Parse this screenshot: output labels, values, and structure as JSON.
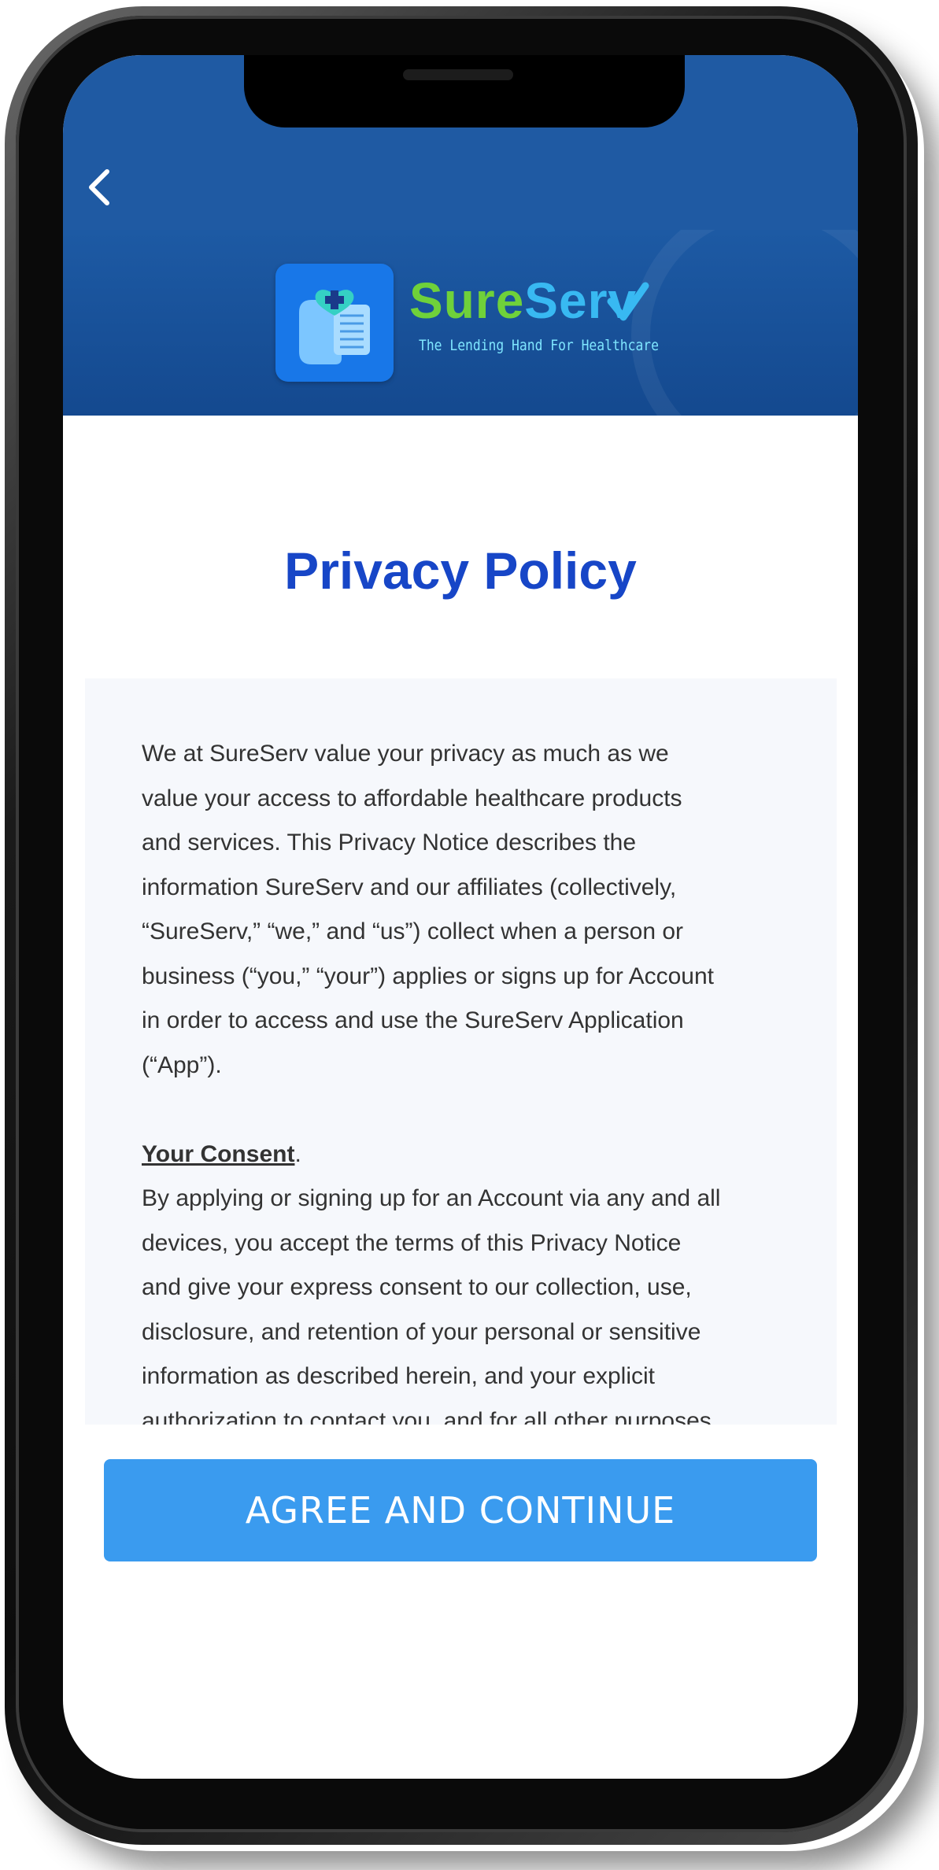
{
  "header": {
    "back_icon": "chevron-left-icon"
  },
  "banner": {
    "brand_sure": "Sure",
    "brand_serv": "Serv",
    "tagline": "The Lending Hand For Healthcare",
    "check_icon": "checkmark-icon",
    "logo_icon": "hands-heart-logo-icon"
  },
  "page": {
    "title": "Privacy Policy"
  },
  "policy": {
    "paragraph_1_lines": [
      "We at SureServ value your privacy as much as we",
      "value your access to affordable healthcare products",
      "and services. This Privacy Notice describes the",
      "information SureServ and our affiliates (collectively,",
      "“SureServ,” “we,” and “us”) collect when a person or",
      "business (“you,” “your”) applies or signs up for Account",
      "in order to access and use the SureServ Application",
      "(“App”)."
    ],
    "consent_heading": "Your Consent",
    "consent_heading_period": ".",
    "paragraph_2_lines": [
      "By applying or signing up for an Account via any and all",
      "devices, you accept the terms of this Privacy Notice",
      "and give your express consent to our collection, use,",
      "disclosure, and retention of your personal or sensitive",
      "information as described herein, and your explicit",
      "authorization to contact you, and for all other purposes"
    ]
  },
  "actions": {
    "agree_label": "AGREE AND CONTINUE"
  },
  "colors": {
    "header_blue": "#1f5aa3",
    "title_blue": "#1746c7",
    "button_blue": "#3a9bef",
    "brand_green": "#6fd13a",
    "brand_cyan": "#38b9f2"
  }
}
